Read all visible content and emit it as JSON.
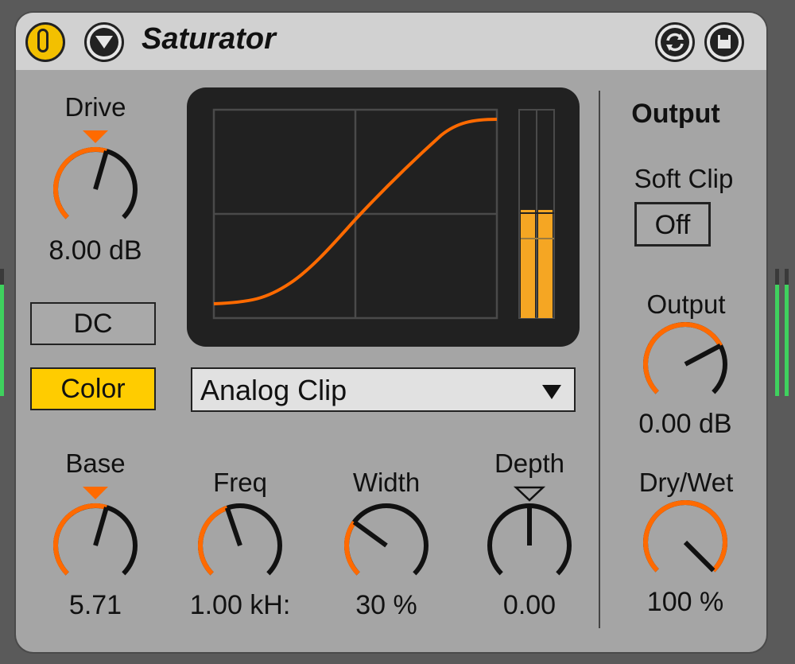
{
  "device": {
    "title": "Saturator"
  },
  "header": {
    "icons": [
      "power-icon",
      "menu-arrow-icon",
      "hot-swap-icon",
      "save-preset-icon"
    ]
  },
  "drive": {
    "label": "Drive",
    "value": "8.00 dB",
    "level": 0.56
  },
  "dc_button": {
    "label": "DC"
  },
  "color_button": {
    "label": "Color",
    "active": true,
    "color": "#ffcc00"
  },
  "curve": {
    "type": "Analog Clip"
  },
  "meters": {
    "left_level": 0.52,
    "right_level": 0.52
  },
  "base": {
    "label": "Base",
    "value": "5.71",
    "level": 0.56
  },
  "freq": {
    "label": "Freq",
    "value": "1.00 kH:",
    "level": 0.43
  },
  "width": {
    "label": "Width",
    "value": "30 %",
    "level": 0.3
  },
  "depth": {
    "label": "Depth",
    "value": "0.00",
    "level": 0.5
  },
  "output_section": {
    "heading": "Output",
    "soft_clip_label": "Soft Clip",
    "soft_clip_value": "Off",
    "output_label": "Output",
    "output_value": "0.00 dB",
    "output_level": 0.73,
    "drywet_label": "Dry/Wet",
    "drywet_value": "100 %",
    "drywet_level": 1.0
  },
  "colors": {
    "accent": "#ff6a00",
    "meter": "#f5a623",
    "panel": "#a5a5a5",
    "display_bg": "#212121"
  }
}
